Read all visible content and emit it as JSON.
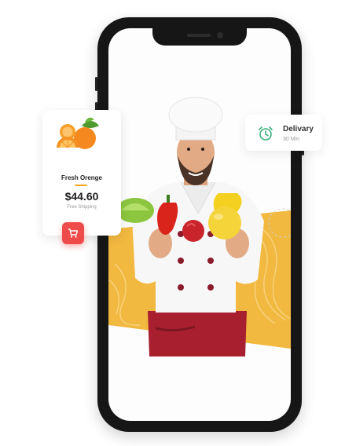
{
  "product_card": {
    "name": "Fresh Orenge",
    "price": "$44.60",
    "shipping": "Free Shipping",
    "fruit_image": "orange-fruit-icon",
    "cart_icon": "cart-icon"
  },
  "delivery_card": {
    "title": "Delivary",
    "time": "30 Min",
    "icon": "alarm-clock-icon"
  },
  "colors": {
    "accent_orange": "#f5a623",
    "cart_red": "#ef4b4b",
    "clock_green": "#3bb07a",
    "banner_yellow": "#f2b940"
  }
}
